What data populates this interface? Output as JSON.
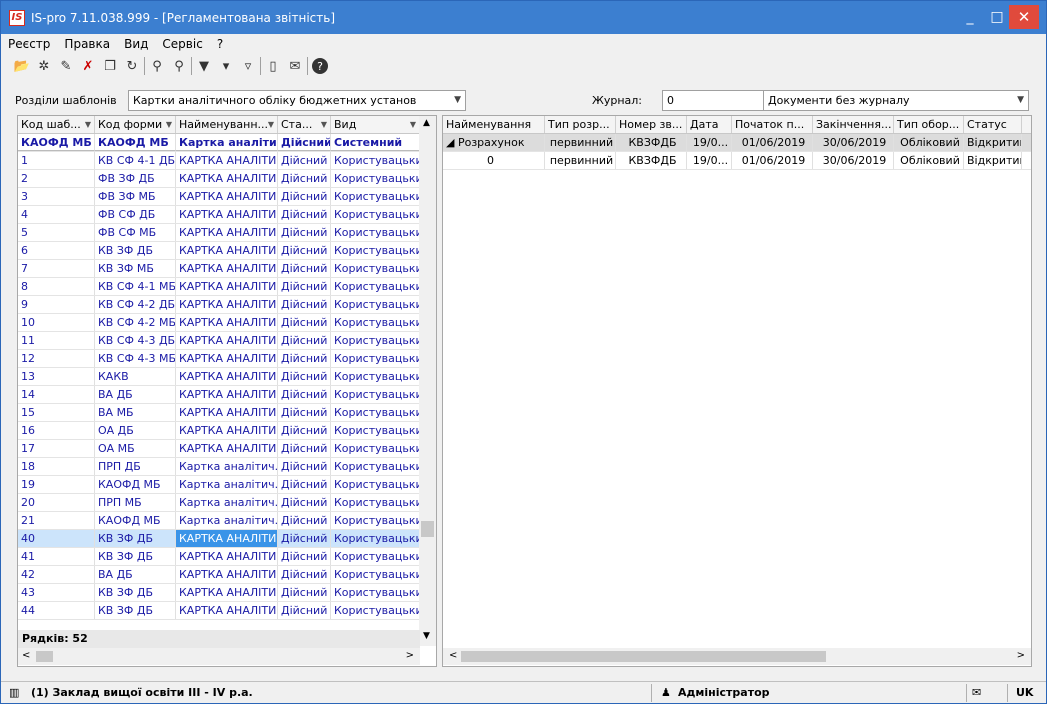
{
  "title": "IS-pro 7.11.038.999 - [Регламентована звітність]",
  "logo_text": "IS",
  "window_controls": {
    "minimize": "_",
    "maximize": "□",
    "close": "✕"
  },
  "menu": [
    "Реєстр",
    "Правка",
    "Вид",
    "Сервіс",
    "?"
  ],
  "toolbar_icons": [
    "open-icon",
    "new-icon",
    "edit-icon",
    "delete-icon",
    "copy-icon",
    "refresh-icon",
    "find-icon",
    "find-next-icon",
    "filter-icon",
    "filter-set-icon",
    "filter-clear-icon",
    "document-icon",
    "mail-icon",
    "help-icon"
  ],
  "sections": {
    "label": "Розділи шаблонів",
    "value": "Картки аналітичного обліку бюджетних установ"
  },
  "journal": {
    "label": "Журнал:",
    "number": "0",
    "value": "Документи без журналу"
  },
  "left_grid": {
    "columns": [
      "Код шаб...",
      "Код форми",
      "Найменуванн...",
      "Ста...",
      "Вид"
    ],
    "filter_row": [
      "КАОФД МБ",
      "КАОФД МБ",
      "Картка аналіти...",
      "Дійсний",
      "Системний"
    ],
    "rows": [
      [
        "1",
        "КВ СФ 4-1 ДБ",
        "КАРТКА АНАЛІТИ...",
        "Дійсний",
        "Користувацький"
      ],
      [
        "2",
        "ФВ ЗФ ДБ",
        "КАРТКА АНАЛІТИ...",
        "Дійсний",
        "Користувацький"
      ],
      [
        "3",
        "ФВ ЗФ МБ",
        "КАРТКА АНАЛІТИ...",
        "Дійсний",
        "Користувацький"
      ],
      [
        "4",
        "ФВ СФ ДБ",
        "КАРТКА АНАЛІТИ...",
        "Дійсний",
        "Користувацький"
      ],
      [
        "5",
        "ФВ СФ МБ",
        "КАРТКА АНАЛІТИ...",
        "Дійсний",
        "Користувацький"
      ],
      [
        "6",
        "КВ ЗФ ДБ",
        "КАРТКА АНАЛІТИ...",
        "Дійсний",
        "Користувацький"
      ],
      [
        "7",
        "КВ ЗФ МБ",
        "КАРТКА АНАЛІТИ...",
        "Дійсний",
        "Користувацький"
      ],
      [
        "8",
        "КВ СФ 4-1 МБ",
        "КАРТКА АНАЛІТИ...",
        "Дійсний",
        "Користувацький"
      ],
      [
        "9",
        "КВ СФ 4-2 ДБ",
        "КАРТКА АНАЛІТИ...",
        "Дійсний",
        "Користувацький"
      ],
      [
        "10",
        "КВ СФ 4-2 МБ",
        "КАРТКА АНАЛІТИ...",
        "Дійсний",
        "Користувацький"
      ],
      [
        "11",
        "КВ СФ 4-3 ДБ",
        "КАРТКА АНАЛІТИ...",
        "Дійсний",
        "Користувацький"
      ],
      [
        "12",
        "КВ СФ 4-3 МБ",
        "КАРТКА АНАЛІТИ...",
        "Дійсний",
        "Користувацький"
      ],
      [
        "13",
        "КАКВ",
        "КАРТКА АНАЛІТИ...",
        "Дійсний",
        "Користувацький"
      ],
      [
        "14",
        "ВА ДБ",
        "КАРТКА АНАЛІТИ...",
        "Дійсний",
        "Користувацький"
      ],
      [
        "15",
        "ВА МБ",
        "КАРТКА АНАЛІТИ...",
        "Дійсний",
        "Користувацький"
      ],
      [
        "16",
        "ОА ДБ",
        "КАРТКА АНАЛІТИ...",
        "Дійсний",
        "Користувацький"
      ],
      [
        "17",
        "ОА МБ",
        "КАРТКА АНАЛІТИ...",
        "Дійсний",
        "Користувацький"
      ],
      [
        "18",
        "ПРП ДБ",
        "Картка аналітич...",
        "Дійсний",
        "Користувацький"
      ],
      [
        "19",
        "КАОФД МБ",
        "Картка аналітич...",
        "Дійсний",
        "Користувацький"
      ],
      [
        "20",
        "ПРП МБ",
        "Картка аналітич...",
        "Дійсний",
        "Користувацький"
      ],
      [
        "21",
        "КАОФД МБ",
        "Картка аналітич...",
        "Дійсний",
        "Користувацький"
      ],
      [
        "40",
        "КВ ЗФ ДБ",
        "КАРТКА АНАЛІТИ...",
        "Дійсний",
        "Користувацький"
      ],
      [
        "41",
        "КВ ЗФ ДБ",
        "КАРТКА АНАЛІТИ...",
        "Дійсний",
        "Користувацький"
      ],
      [
        "42",
        "ВА ДБ",
        "КАРТКА АНАЛІТИ...",
        "Дійсний",
        "Користувацький"
      ],
      [
        "43",
        "КВ ЗФ ДБ",
        "КАРТКА АНАЛІТИ...",
        "Дійсний",
        "Користувацький"
      ],
      [
        "44",
        "КВ ЗФ ДБ",
        "КАРТКА АНАЛІТИ...",
        "Дійсний",
        "Користувацький"
      ]
    ],
    "selected_index": 21,
    "rows_count_label": "Рядків: 52"
  },
  "right_grid": {
    "columns": [
      "Найменування",
      "Тип розр...",
      "Номер зв...",
      "Дата",
      "Початок п...",
      "Закінчення...",
      "Тип обор...",
      "Статус"
    ],
    "rows": [
      [
        "◢  Розрахунок",
        "первинний",
        "КВЗФДБ",
        "19/0...",
        "01/06/2019",
        "30/06/2019",
        "Обліковий",
        "Відкритий"
      ],
      [
        "0",
        "первинний",
        "КВЗФДБ",
        "19/0...",
        "01/06/2019",
        "30/06/2019",
        "Обліковий",
        "Відкритий"
      ]
    ]
  },
  "status_bar": {
    "org": "(1) Заклад вищої освіти ІІІ - IV р.а.",
    "user": "Адміністратор",
    "lang": "UK"
  }
}
